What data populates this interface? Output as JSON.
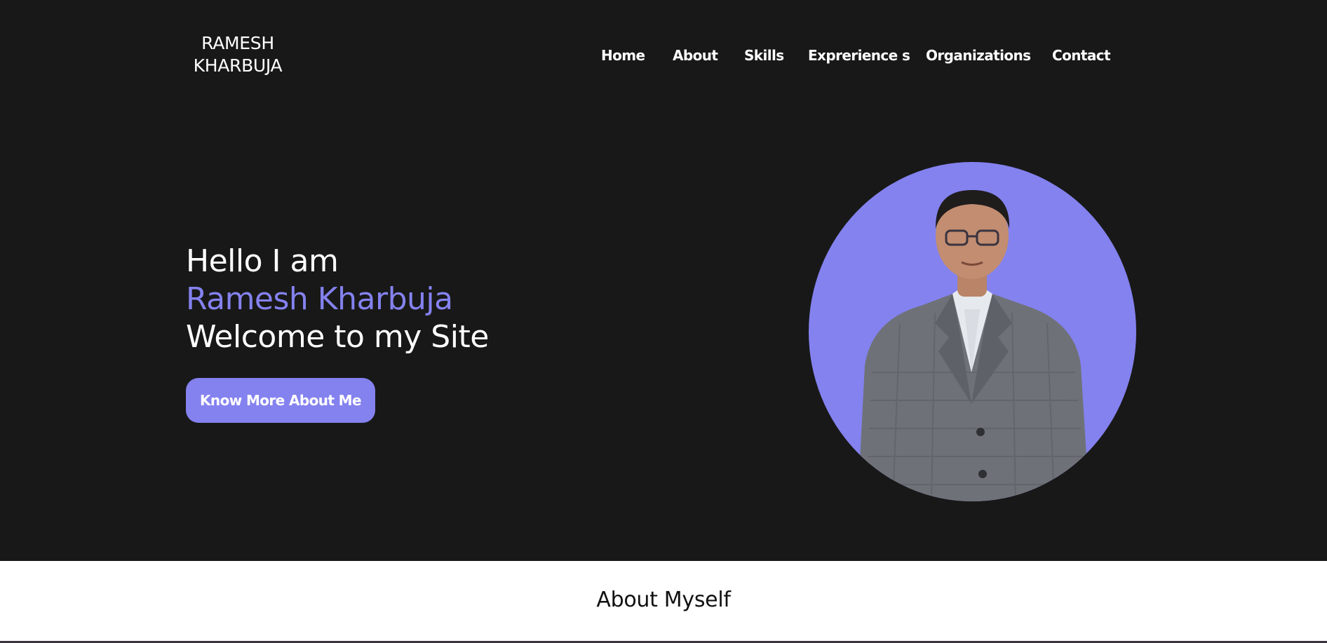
{
  "brand": {
    "line1": "RAMESH",
    "line2": "KHARBUJA"
  },
  "nav": {
    "items": [
      {
        "label": "Home"
      },
      {
        "label": "About"
      },
      {
        "label": "Skills"
      },
      {
        "label": "Exprerience s"
      },
      {
        "label": "Organizations"
      },
      {
        "label": "Contact"
      }
    ]
  },
  "hero": {
    "greeting": "Hello I am",
    "name": "Ramesh Kharbuja",
    "welcome": "Welcome to my Site",
    "cta_label": "Know More About Me"
  },
  "about": {
    "title": "About Myself"
  },
  "colors": {
    "background": "#181818",
    "accent": "#8482ef",
    "text": "#ffffff"
  }
}
